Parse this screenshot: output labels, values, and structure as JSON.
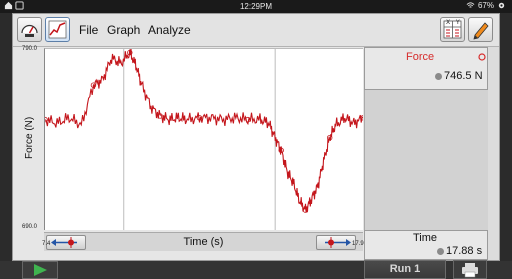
{
  "status_bar": {
    "time": "12:29PM",
    "battery": "67%"
  },
  "toolbar": {
    "menus": [
      "File",
      "Graph",
      "Analyze"
    ],
    "table_icon_text": "X Y"
  },
  "graph": {
    "y_axis_label": "Force (N)",
    "y_max_label": "790.0",
    "y_min_label": "690.0",
    "x_axis_label": "Time (s)",
    "x_min_label": "7.4",
    "x_max_label": "17.9",
    "line_color": "#c4161c"
  },
  "chart_data": {
    "type": "line",
    "xlabel": "Time (s)",
    "ylabel": "Force (N)",
    "xlim": [
      7.4,
      17.9
    ],
    "ylim": [
      690.0,
      790.0
    ],
    "grid": true,
    "series": [
      {
        "x": [
          7.4,
          7.8,
          8.2,
          8.6,
          9.0,
          9.3,
          9.6,
          9.9,
          10.2,
          10.4,
          10.6,
          10.9,
          11.2,
          11.5,
          11.8,
          12.1,
          12.5,
          12.9,
          13.3,
          13.7,
          14.1,
          14.5,
          14.8,
          15.0,
          15.2,
          15.4,
          15.6,
          15.8,
          16.0,
          16.2,
          16.4,
          16.6,
          16.8,
          17.0,
          17.3,
          17.6,
          17.9
        ],
        "y": [
          751,
          749,
          752,
          748,
          770,
          773,
          785,
          782,
          788,
          781,
          770,
          758,
          753,
          751,
          752,
          751,
          752,
          752,
          751,
          752,
          751,
          751,
          749,
          741,
          734,
          722,
          716,
          706,
          701,
          707,
          714,
          728,
          741,
          748,
          752,
          749,
          752
        ]
      }
    ]
  },
  "meters": {
    "force": {
      "label": "Force",
      "value": "746.5 N",
      "color": "#d62c2c"
    },
    "time": {
      "label": "Time",
      "value": "17.88 s"
    }
  },
  "bottom": {
    "run_label": "Run 1"
  }
}
